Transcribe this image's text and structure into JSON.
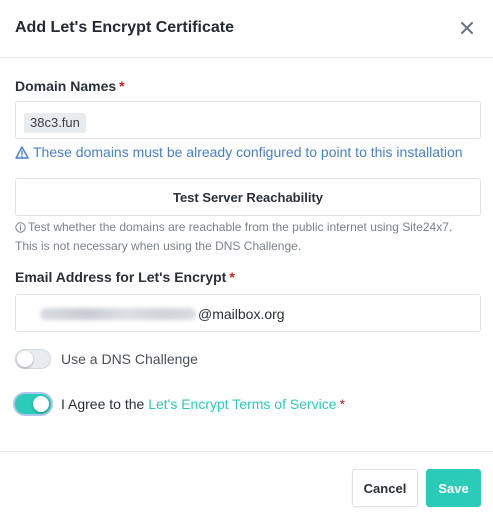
{
  "modal": {
    "title": "Add Let's Encrypt Certificate"
  },
  "domain_names": {
    "label": "Domain Names",
    "required_mark": "*",
    "tags": [
      "38c3.fun"
    ],
    "warning": "These domains must be already configured to point to this installation"
  },
  "test_button": {
    "label": "Test Server Reachability"
  },
  "test_note": {
    "line1": "Test whether the domains are reachable from the public internet using Site24x7.",
    "line2": "This is not necessary when using the DNS Challenge."
  },
  "email": {
    "label": "Email Address for Let's Encrypt",
    "required_mark": "*",
    "visible_domain": "@mailbox.org"
  },
  "dns_challenge": {
    "label": "Use a DNS Challenge",
    "enabled": false
  },
  "agree": {
    "prefix": "I Agree to the",
    "link_text": "Let's Encrypt Terms of Service",
    "required_mark": "*",
    "enabled": true
  },
  "footer": {
    "cancel_label": "Cancel",
    "save_label": "Save"
  },
  "colors": {
    "accent": "#2bcbba",
    "link_blue": "#467fcf",
    "required_red": "#cd201f"
  },
  "icons": {
    "close": "close-icon",
    "warning": "warning-triangle-icon",
    "info": "info-circle-icon"
  }
}
